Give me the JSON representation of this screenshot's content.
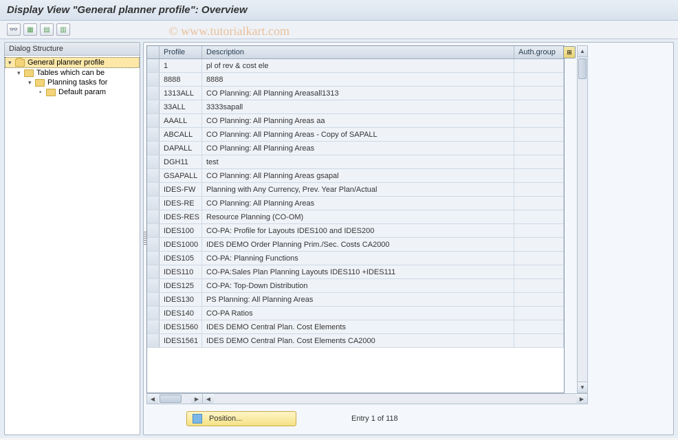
{
  "title": "Display View \"General planner profile\": Overview",
  "watermark": "© www.tutorialkart.com",
  "sidebar": {
    "header": "Dialog Structure",
    "items": [
      {
        "label": "General planner profile",
        "selected": true
      },
      {
        "label": "Tables which can be"
      },
      {
        "label": "Planning tasks for"
      },
      {
        "label": "Default param"
      }
    ]
  },
  "table": {
    "columns": {
      "profile": "Profile",
      "description": "Description",
      "auth": "Auth.group"
    },
    "rows": [
      {
        "profile": "1",
        "description": "pl of rev & cost ele",
        "auth": ""
      },
      {
        "profile": "8888",
        "description": "8888",
        "auth": ""
      },
      {
        "profile": "1313ALL",
        "description": "CO Planning: All Planning Areasall1313",
        "auth": ""
      },
      {
        "profile": "33ALL",
        "description": "3333sapall",
        "auth": ""
      },
      {
        "profile": "AAALL",
        "description": "CO Planning: All Planning Areas aa",
        "auth": ""
      },
      {
        "profile": "ABCALL",
        "description": "CO Planning: All Planning Areas - Copy of SAPALL",
        "auth": ""
      },
      {
        "profile": "DAPALL",
        "description": "CO Planning: All Planning Areas",
        "auth": ""
      },
      {
        "profile": "DGH11",
        "description": "test",
        "auth": ""
      },
      {
        "profile": "GSAPALL",
        "description": "CO Planning: All Planning Areas gsapal",
        "auth": ""
      },
      {
        "profile": "IDES-FW",
        "description": "Planning with Any Currency, Prev. Year Plan/Actual",
        "auth": ""
      },
      {
        "profile": "IDES-RE",
        "description": "CO Planning: All Planning Areas",
        "auth": ""
      },
      {
        "profile": "IDES-RES",
        "description": "Resource Planning (CO-OM)",
        "auth": ""
      },
      {
        "profile": "IDES100",
        "description": "CO-PA: Profile for Layouts IDES100 and IDES200",
        "auth": ""
      },
      {
        "profile": "IDES1000",
        "description": "IDES DEMO Order Planning Prim./Sec. Costs   CA2000",
        "auth": ""
      },
      {
        "profile": "IDES105",
        "description": "CO-PA: Planning Functions",
        "auth": ""
      },
      {
        "profile": "IDES110",
        "description": "CO-PA:Sales Plan Planning Layouts IDES110 +IDES111",
        "auth": ""
      },
      {
        "profile": "IDES125",
        "description": "CO-PA: Top-Down Distribution",
        "auth": ""
      },
      {
        "profile": "IDES130",
        "description": "PS Planning: All Planning Areas",
        "auth": ""
      },
      {
        "profile": "IDES140",
        "description": "CO-PA Ratios",
        "auth": ""
      },
      {
        "profile": "IDES1560",
        "description": "IDES DEMO Central Plan. Cost Elements",
        "auth": ""
      },
      {
        "profile": "IDES1561",
        "description": "IDES DEMO Central Plan. Cost Elements      CA2000",
        "auth": ""
      }
    ]
  },
  "footer": {
    "position_label": "Position...",
    "status": "Entry 1 of 118"
  }
}
